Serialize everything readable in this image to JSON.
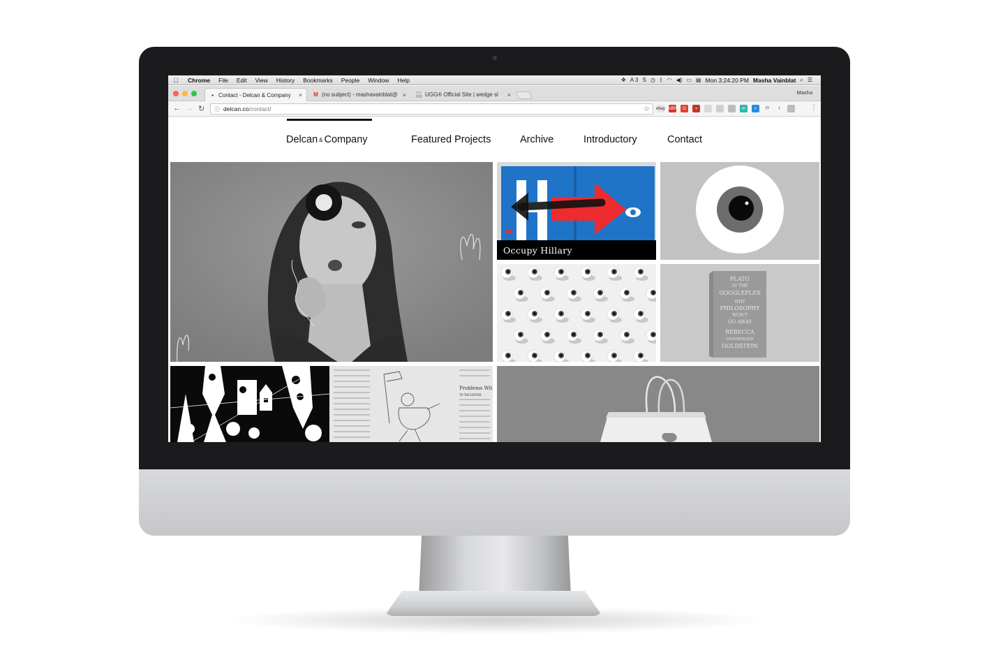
{
  "menubar": {
    "app": "Chrome",
    "items": [
      "File",
      "Edit",
      "View",
      "History",
      "Bookmarks",
      "People",
      "Window",
      "Help"
    ],
    "clock": "Mon 3:24:20 PM",
    "user": "Masha Vainblat",
    "status_icons": [
      "dropbox-icon",
      "adobe-icon",
      "skype-icon",
      "timemachine-icon",
      "bluetooth-icon",
      "wifi-icon",
      "volume-icon",
      "battery-icon",
      "flag-icon",
      "search-icon",
      "list-icon"
    ]
  },
  "browser": {
    "tabs": [
      {
        "label": "Contact - Delcan & Company",
        "favicon": "page-icon",
        "active": true
      },
      {
        "label": "(no subject) - mashavainblat@",
        "favicon": "gmail-icon",
        "active": false
      },
      {
        "label": "UGG® Official Site | wedge sl",
        "favicon": "ugg-icon",
        "active": false
      }
    ],
    "profile": "Masha",
    "url_host": "delcan.co",
    "url_path": "/contact/",
    "extensions": [
      {
        "name": "ebay-ext",
        "label": "ebay",
        "color": "#e6e6e6"
      },
      {
        "name": "abp-ext",
        "label": "ABP",
        "color": "#d9342b"
      },
      {
        "name": "opera-ext",
        "label": "O",
        "color": "#e0402f"
      },
      {
        "name": "red-ext",
        "label": "▪",
        "color": "#c8342c"
      },
      {
        "name": "circle-ext",
        "label": "",
        "color": "#d8d8d8"
      },
      {
        "name": "triangle-ext",
        "label": "",
        "color": "#cfcfcf"
      },
      {
        "name": "puzzle-ext",
        "label": "",
        "color": "#bdbdbd"
      },
      {
        "name": "teal-ext",
        "label": "m",
        "color": "#2fb5a8"
      },
      {
        "name": "blue-ext",
        "label": "✓",
        "color": "#2c8bd8"
      },
      {
        "name": "font-ext",
        "label": "f?",
        "color": "#f5f5f5"
      },
      {
        "name": "r-ext",
        "label": "r",
        "color": "#f5f5f5"
      },
      {
        "name": "grey-ext",
        "label": "",
        "color": "#bcbcbc"
      }
    ]
  },
  "site": {
    "brand_left": "Delcan",
    "brand_amp": "&",
    "brand_right": "Company",
    "nav": [
      "Featured Projects",
      "Archive",
      "Introductory",
      "Contact"
    ],
    "tiles": {
      "occupy_caption": "Occupy Hillary",
      "book_lines": [
        "PLATO",
        "AT THE",
        "GOOGLEPLEX",
        "WHY",
        "PHILOSOPHY",
        "WON'T",
        "GO AWAY",
        "REBECCA",
        "NEWBERGER",
        "GOLDSTEIN"
      ],
      "newspaper_heading": "Problems With",
      "newspaper_sub": "TO THE EDITOR:"
    }
  },
  "colors": {
    "hillary_blue": "#1f74c8",
    "hillary_red": "#ee2b2f",
    "bezel": "#1b1b1d"
  }
}
